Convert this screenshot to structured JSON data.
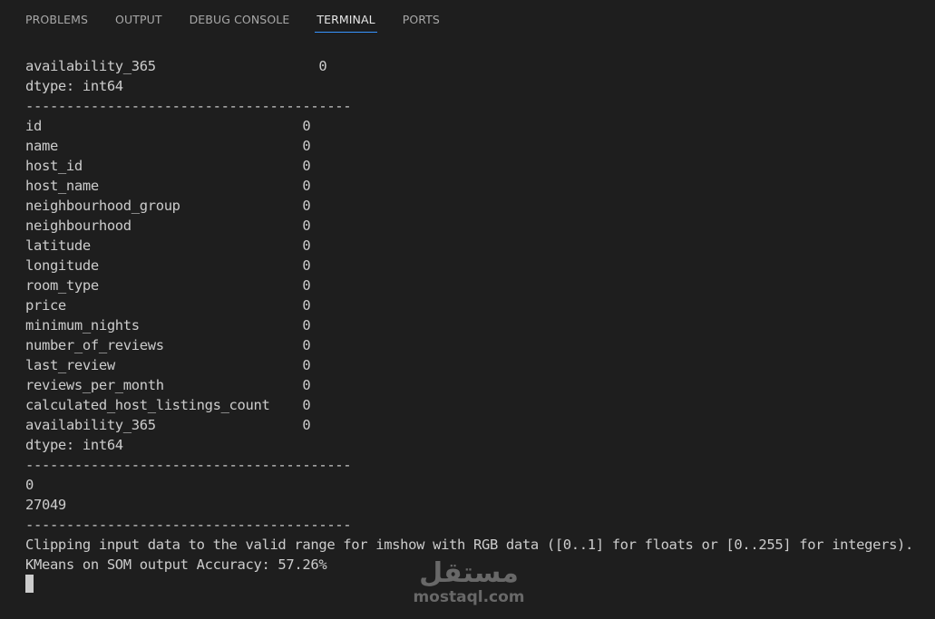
{
  "tabs": [
    {
      "label": "PROBLEMS",
      "active": false
    },
    {
      "label": "OUTPUT",
      "active": false
    },
    {
      "label": "DEBUG CONSOLE",
      "active": false
    },
    {
      "label": "TERMINAL",
      "active": true
    },
    {
      "label": "PORTS",
      "active": false
    }
  ],
  "terminal": {
    "lines": [
      "availability_365                    0",
      "dtype: int64",
      "----------------------------------------",
      "id                                0",
      "name                              0",
      "host_id                           0",
      "host_name                         0",
      "neighbourhood_group               0",
      "neighbourhood                     0",
      "latitude                          0",
      "longitude                         0",
      "room_type                         0",
      "price                             0",
      "minimum_nights                    0",
      "number_of_reviews                 0",
      "last_review                       0",
      "reviews_per_month                 0",
      "calculated_host_listings_count    0",
      "availability_365                  0",
      "dtype: int64",
      "----------------------------------------",
      "0",
      "27049",
      "----------------------------------------",
      "Clipping input data to the valid range for imshow with RGB data ([0..1] for floats or [0..255] for integers).",
      "KMeans on SOM output Accuracy: 57.26%"
    ]
  },
  "watermark": {
    "arabic": "مستقل",
    "latin": "mostaql.com"
  },
  "colors": {
    "background": "#1e1e1e",
    "text": "#cccccc",
    "active_tab_underline": "#3794ff"
  }
}
